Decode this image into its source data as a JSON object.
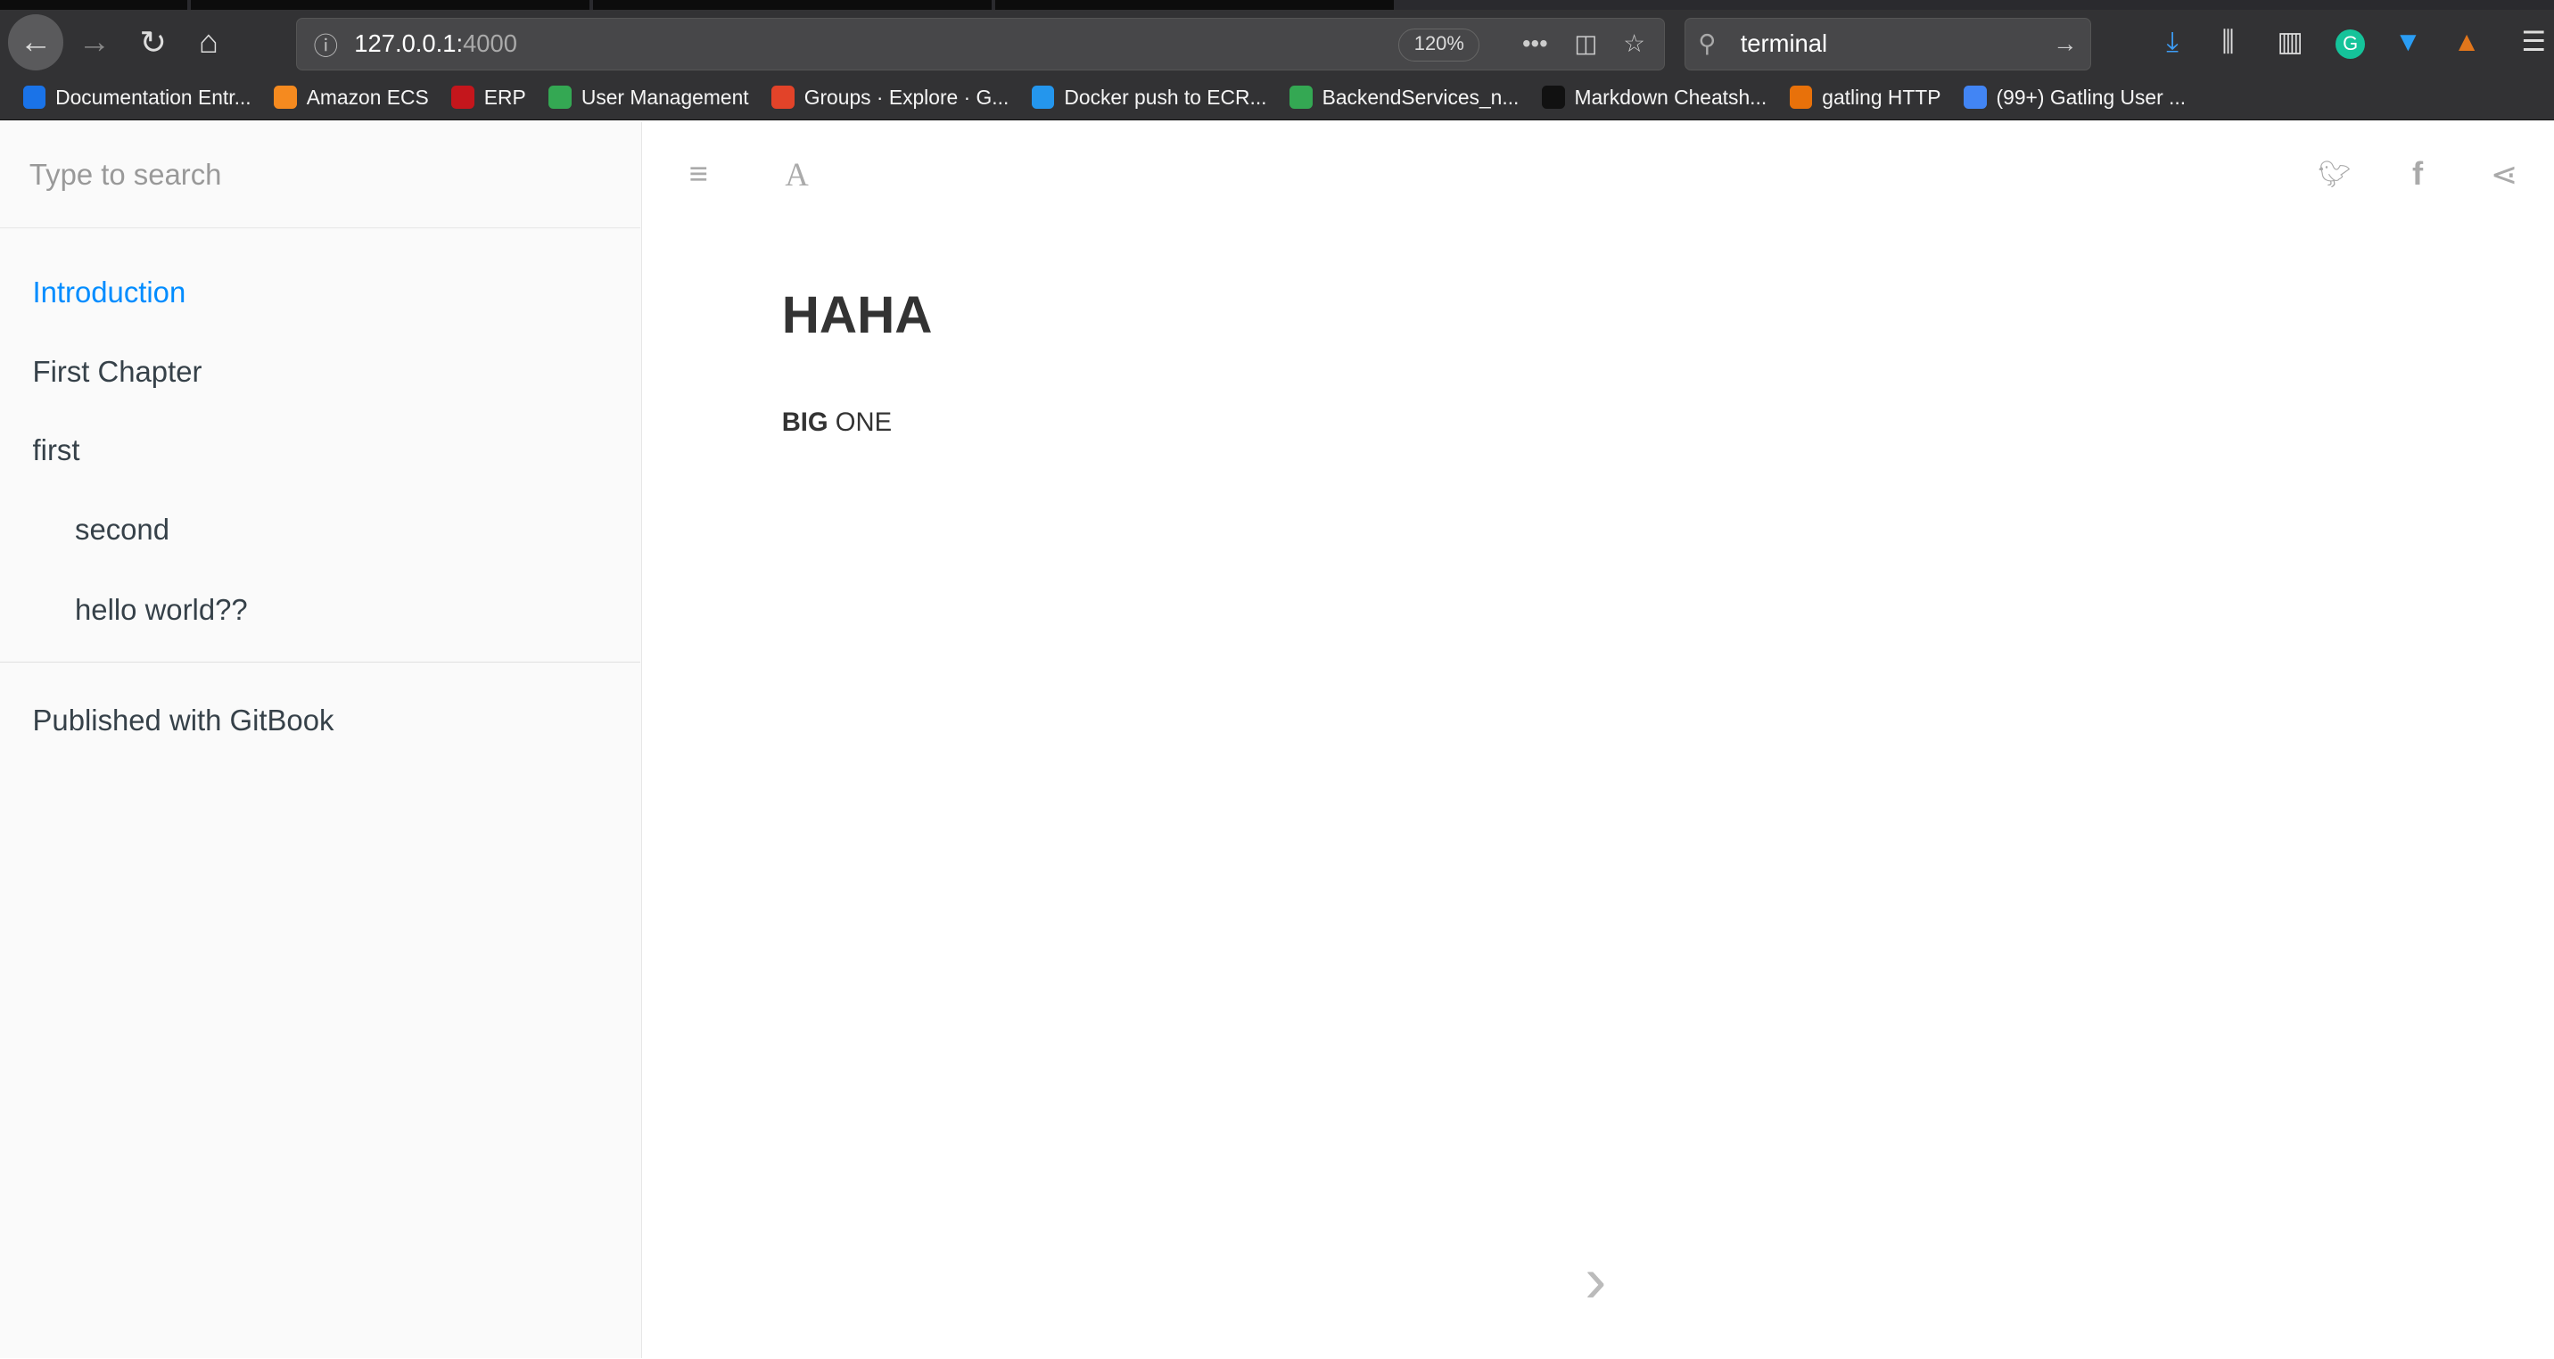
{
  "browser": {
    "url_host": "127.0.0.1:",
    "url_port": "4000",
    "zoom": "120%",
    "search_value": "terminal",
    "bookmarks": [
      {
        "label": "Documentation Entr...",
        "color": "#1a73e8"
      },
      {
        "label": "Amazon ECS",
        "color": "#f58a1f"
      },
      {
        "label": "ERP",
        "color": "#c4161c"
      },
      {
        "label": "User Management",
        "color": "#34a853"
      },
      {
        "label": "Groups · Explore · G...",
        "color": "#e24329"
      },
      {
        "label": "Docker push to ECR...",
        "color": "#2496ed"
      },
      {
        "label": "BackendServices_n...",
        "color": "#34a853"
      },
      {
        "label": "Markdown Cheatsh...",
        "color": "#111111"
      },
      {
        "label": "gatling HTTP",
        "color": "#e8710a"
      },
      {
        "label": "(99+) Gatling User ...",
        "color": "#4285f4"
      }
    ]
  },
  "sidebar": {
    "search_placeholder": "Type to search",
    "items": [
      {
        "label": "Introduction",
        "active": true
      },
      {
        "label": "First Chapter"
      },
      {
        "label": "first"
      },
      {
        "label": "second"
      },
      {
        "label": "hello world??"
      }
    ],
    "footer": "Published with GitBook"
  },
  "page": {
    "title": "HAHA",
    "body_bold": "BIG",
    "body_rest": " ONE"
  },
  "colors": {
    "accent": "#008cff",
    "chrome": "#323234"
  }
}
